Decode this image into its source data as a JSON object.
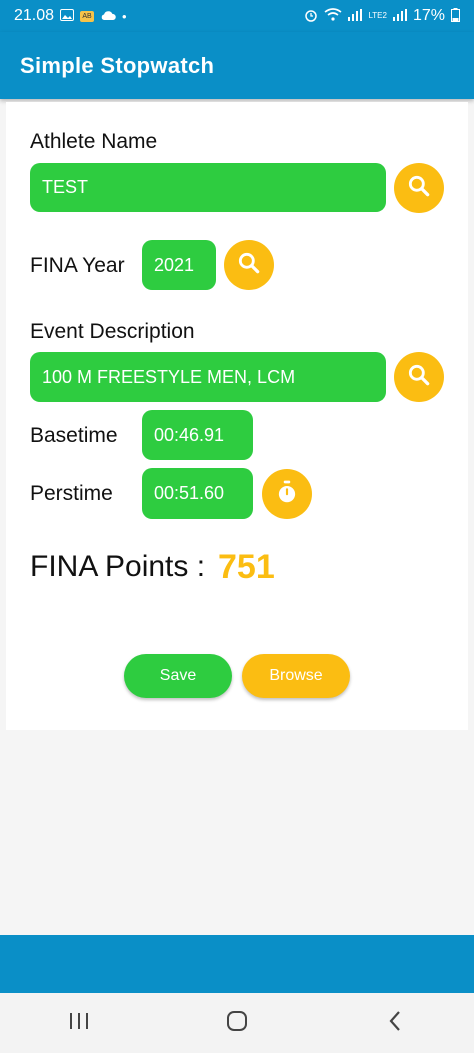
{
  "status_bar": {
    "time": "21.08",
    "battery": "17%",
    "network": "LTE2"
  },
  "app_bar": {
    "title": "Simple Stopwatch"
  },
  "form": {
    "athlete_label": "Athlete Name",
    "athlete_value": "TEST",
    "year_label": "FINA Year",
    "year_value": "2021",
    "event_label": "Event Description",
    "event_value": "100 M FREESTYLE MEN, LCM",
    "basetime_label": "Basetime",
    "basetime_value": "00:46.91",
    "perstime_label": "Perstime",
    "perstime_value": "00:51.60"
  },
  "points": {
    "label": "FINA Points :",
    "value": "751"
  },
  "actions": {
    "save_label": "Save",
    "browse_label": "Browse"
  },
  "colors": {
    "primary": "#0a8fc7",
    "field_green": "#2ecc40",
    "accent_yellow": "#fbbd12"
  },
  "icons": {
    "search": "search-icon",
    "stopwatch": "stopwatch-icon"
  }
}
